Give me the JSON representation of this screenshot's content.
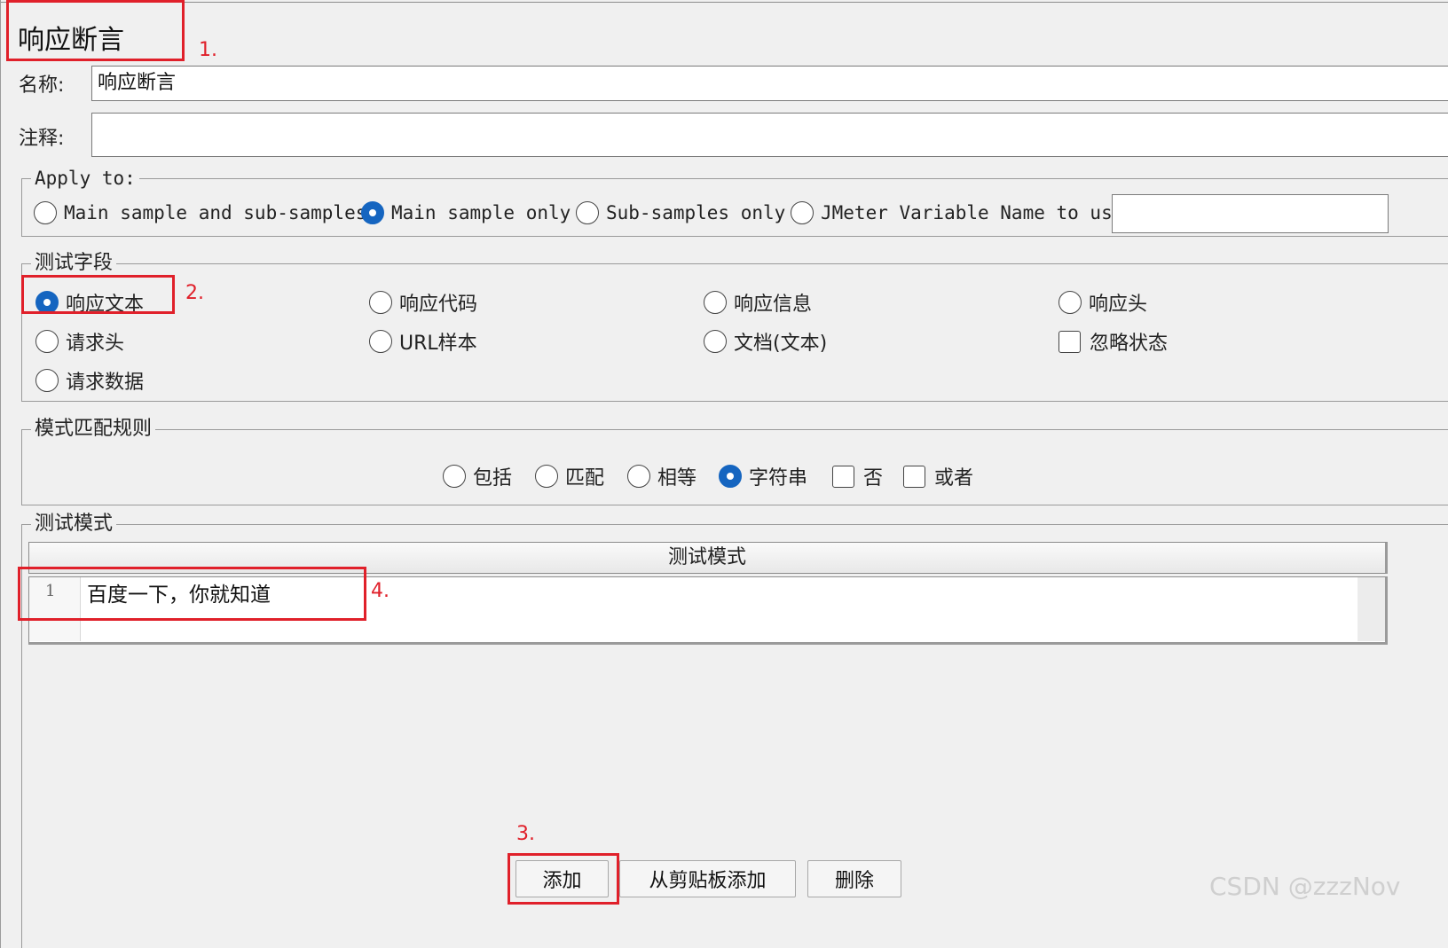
{
  "panel": {
    "title": "响应断言"
  },
  "name_field": {
    "label": "名称:",
    "value": "响应断言"
  },
  "comment_field": {
    "label": "注释:",
    "value": ""
  },
  "apply_to": {
    "legend": "Apply to:",
    "options": [
      "Main sample and sub-samples",
      "Main sample only",
      "Sub-samples only",
      "JMeter Variable Name to use"
    ],
    "selected": "Main sample only",
    "variable_value": ""
  },
  "test_field": {
    "legend": "测试字段",
    "radios": [
      "响应文本",
      "响应代码",
      "响应信息",
      "响应头",
      "请求头",
      "URL样本",
      "文档(文本)",
      "请求数据"
    ],
    "selected": "响应文本",
    "checkbox": {
      "label": "忽略状态",
      "checked": false
    }
  },
  "pattern_rule": {
    "legend": "模式匹配规则",
    "radios": [
      "包括",
      "匹配",
      "相等",
      "字符串"
    ],
    "selected": "字符串",
    "checkboxes": [
      {
        "label": "否",
        "checked": false
      },
      {
        "label": "或者",
        "checked": false
      }
    ]
  },
  "test_pattern": {
    "legend": "测试模式",
    "column_header": "测试模式",
    "rows": [
      {
        "line_no": "1",
        "text": "百度一下，你就知道"
      }
    ]
  },
  "buttons": {
    "add": "添加",
    "add_from_clipboard": "从剪贴板添加",
    "delete": "删除"
  },
  "annotations": [
    "1.",
    "2.",
    "3.",
    "4."
  ],
  "colors": {
    "accent": "#1565c0",
    "annotation": "#e0202a"
  },
  "watermark": "CSDN @zzzNov"
}
